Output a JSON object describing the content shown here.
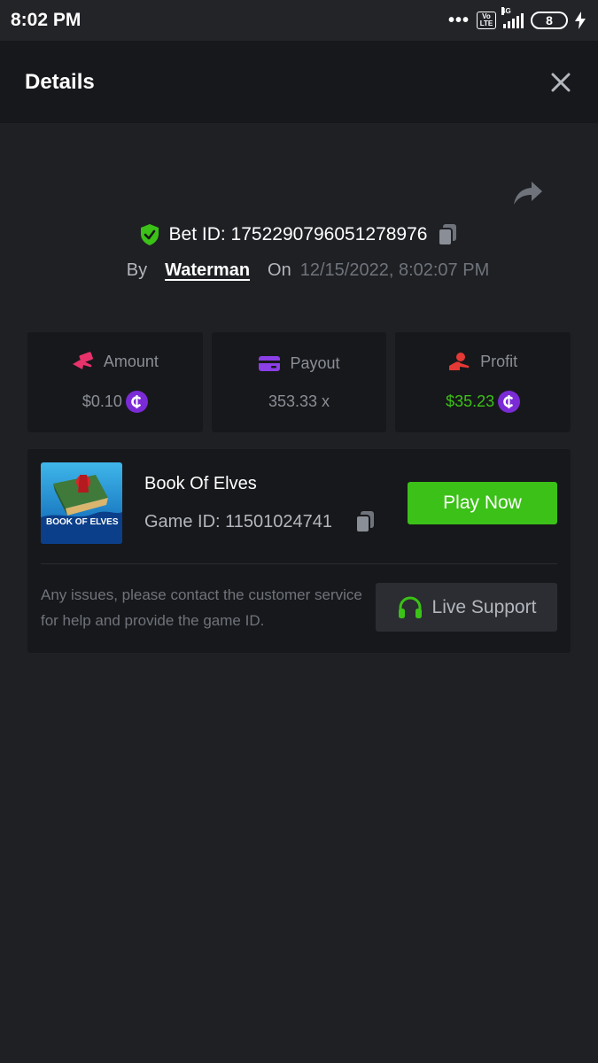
{
  "status_bar": {
    "time": "8:02 PM",
    "volte": "Vo LTE",
    "network": "4G",
    "battery": "8"
  },
  "header": {
    "title": "Details"
  },
  "bet": {
    "id_text": "Bet ID: 1752290796051278976",
    "by_label": "By",
    "user": "Waterman",
    "on_label": "On",
    "date": "12/15/2022, 8:02:07 PM"
  },
  "stats": [
    {
      "label": "Amount",
      "value": "$0.10",
      "icon": "money-hand-icon",
      "color": "#e8326b"
    },
    {
      "label": "Payout",
      "value": "353.33 x",
      "icon": "wallet-icon",
      "color": "#8b3fe6"
    },
    {
      "label": "Profit",
      "value": "$35.23",
      "icon": "profit-hand-icon",
      "color": "#e53935"
    }
  ],
  "game": {
    "name": "Book Of Elves",
    "id_text": "Game ID: 11501024741",
    "thumb_text": "BOOK OF ELVES",
    "play_label": "Play Now",
    "help_text": "Any issues, please contact the customer service for help and provide the game ID.",
    "support_label": "Live Support"
  },
  "colors": {
    "background": "#1f2024",
    "card": "#17181b",
    "accent_green": "#3bc117",
    "coin_purple": "#7b2bd6"
  }
}
